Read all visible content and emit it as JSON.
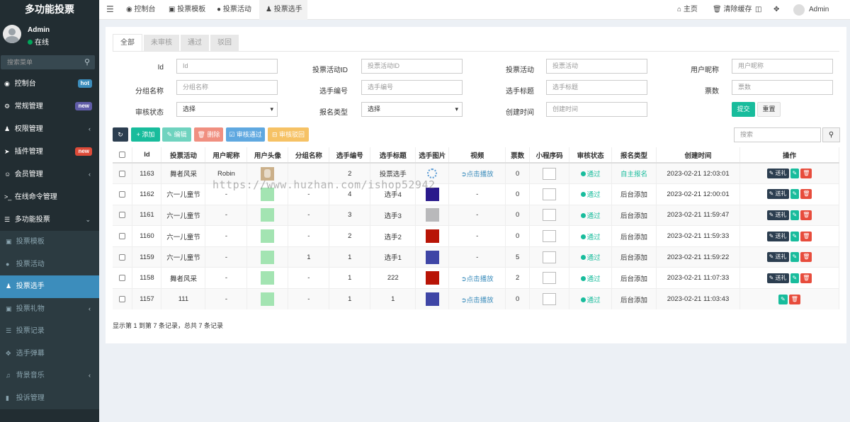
{
  "app": {
    "title": "多功能投票"
  },
  "user": {
    "name": "Admin",
    "status": "在线"
  },
  "sidebar": {
    "search_placeholder": "搜索菜单",
    "items": [
      {
        "label": "控制台",
        "badge": "hot",
        "badge_color": "#3c8dbc",
        "icon": "dashboard-icon"
      },
      {
        "label": "常规管理",
        "badge": "new",
        "badge_color": "#605ca8",
        "icon": "gears-icon"
      },
      {
        "label": "权限管理",
        "icon": "group-icon",
        "chevron": "‹"
      },
      {
        "label": "插件管理",
        "badge": "new",
        "badge_color": "#dd4b39",
        "icon": "rocket-icon"
      },
      {
        "label": "会员管理",
        "icon": "user-circle-icon",
        "chevron": "‹"
      },
      {
        "label": "在线命令管理",
        "icon": "terminal-icon"
      },
      {
        "label": "多功能投票",
        "icon": "list-icon",
        "chevron": "⌄"
      }
    ],
    "subitems": [
      {
        "label": "投票模板",
        "icon": "template-icon"
      },
      {
        "label": "投票活动",
        "icon": "bomb-icon"
      },
      {
        "label": "投票选手",
        "icon": "user-plus-icon",
        "active": true
      },
      {
        "label": "投票礼物",
        "icon": "gift-icon",
        "chevron": "‹"
      },
      {
        "label": "投票记录",
        "icon": "records-icon"
      },
      {
        "label": "选手弹幕",
        "icon": "barrage-icon"
      },
      {
        "label": "背景音乐",
        "icon": "music-icon",
        "chevron": "‹"
      },
      {
        "label": "投诉管理",
        "icon": "bookmark-icon"
      }
    ]
  },
  "topbar": {
    "tabs": [
      "控制台",
      "投票模板",
      "投票活动",
      "投票选手"
    ],
    "home": "主页",
    "clear_cache": "清除缓存",
    "admin": "Admin"
  },
  "filter_tabs": [
    "全部",
    "未审核",
    "通过",
    "驳回"
  ],
  "form": {
    "fields": [
      {
        "label": "Id",
        "placeholder": "Id"
      },
      {
        "label": "投票活动ID",
        "placeholder": "投票活动ID"
      },
      {
        "label": "投票活动",
        "placeholder": "投票活动"
      },
      {
        "label": "用户昵称",
        "placeholder": "用户昵称"
      },
      {
        "label": "分组名称",
        "placeholder": "分组名称"
      },
      {
        "label": "选手编号",
        "placeholder": "选手编号"
      },
      {
        "label": "选手标题",
        "placeholder": "选手标题"
      },
      {
        "label": "票数",
        "placeholder": "票数"
      },
      {
        "label": "审核状态",
        "placeholder": "选择"
      },
      {
        "label": "报名类型",
        "placeholder": "选择"
      },
      {
        "label": "创建时间",
        "placeholder": "创建时间"
      }
    ],
    "submit": "提交",
    "reset": "重置"
  },
  "toolbar": {
    "add": "添加",
    "edit": "编辑",
    "delete": "删除",
    "approve": "审核通过",
    "reject": "审核驳回",
    "search_placeholder": "搜索"
  },
  "table": {
    "headers": [
      "Id",
      "投票活动",
      "用户昵称",
      "用户头像",
      "分组名称",
      "选手编号",
      "选手标题",
      "选手图片",
      "视频",
      "票数",
      "小程序码",
      "审核状态",
      "报名类型",
      "创建时间",
      "操作"
    ],
    "rows": [
      {
        "id": "1163",
        "activity": "舞者风采",
        "nickname": "Robin",
        "group": "",
        "number": "2",
        "title": "投票选手",
        "image": "loader",
        "video": "点击播放",
        "votes": "0",
        "status": "通过",
        "type": "自主报名",
        "created": "2023-02-21 12:03:01",
        "gift": true
      },
      {
        "id": "1162",
        "activity": "六一儿童节",
        "nickname": "-",
        "group": "-",
        "number": "4",
        "title": "选手4",
        "image": "#2a1a8c",
        "video": "-",
        "votes": "0",
        "status": "通过",
        "type": "后台添加",
        "created": "2023-02-21 12:00:01",
        "gift": true
      },
      {
        "id": "1161",
        "activity": "六一儿童节",
        "nickname": "-",
        "group": "-",
        "number": "3",
        "title": "选手3",
        "image": "#b9b9bb",
        "video": "-",
        "votes": "0",
        "status": "通过",
        "type": "后台添加",
        "created": "2023-02-21 11:59:47",
        "gift": true
      },
      {
        "id": "1160",
        "activity": "六一儿童节",
        "nickname": "-",
        "group": "-",
        "number": "2",
        "title": "选手2",
        "image": "#b81406",
        "video": "-",
        "votes": "0",
        "status": "通过",
        "type": "后台添加",
        "created": "2023-02-21 11:59:33",
        "gift": true
      },
      {
        "id": "1159",
        "activity": "六一儿童节",
        "nickname": "-",
        "group": "1",
        "number": "1",
        "title": "选手1",
        "image": "#3f46a6",
        "video": "-",
        "votes": "5",
        "status": "通过",
        "type": "后台添加",
        "created": "2023-02-21 11:59:22",
        "gift": true
      },
      {
        "id": "1158",
        "activity": "舞者风采",
        "nickname": "-",
        "group": "-",
        "number": "1",
        "title": "222",
        "image": "#b81406",
        "video": "点击播放",
        "votes": "2",
        "status": "通过",
        "type": "后台添加",
        "created": "2023-02-21 11:07:33",
        "gift": true
      },
      {
        "id": "1157",
        "activity": "111",
        "nickname": "-",
        "group": "-",
        "number": "1",
        "title": "1",
        "image": "#3f46a6",
        "video": "点击播放",
        "votes": "0",
        "status": "通过",
        "type": "后台添加",
        "created": "2023-02-21 11:03:43",
        "gift": false
      }
    ],
    "gift_label": "送礼",
    "summary": "显示第 1 到第 7 条记录，总共 7 条记录"
  },
  "colors": {
    "avatar_green": "#a3e4b2",
    "teal": "#18bc9c",
    "blue": "#3c8dbc"
  },
  "watermark": "https://www.huzhan.com/ishop52942"
}
